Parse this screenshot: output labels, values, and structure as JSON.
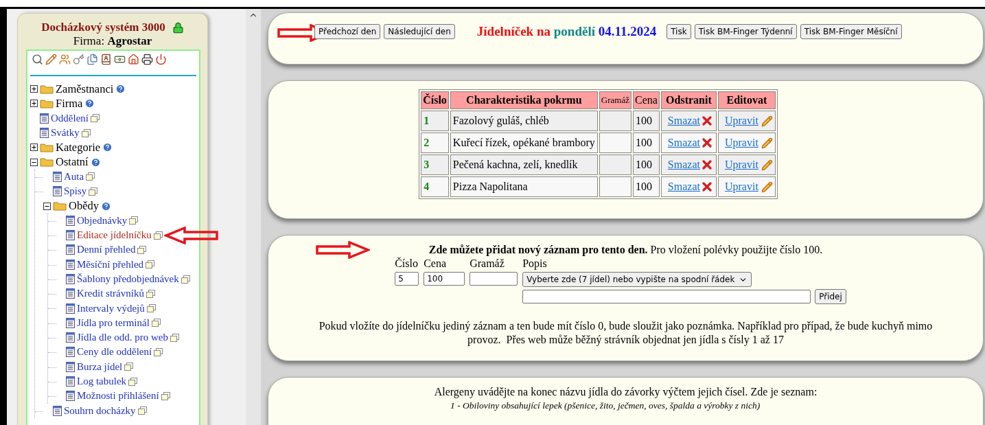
{
  "sidebar": {
    "title": "Docházkový systém 3000",
    "company_label": "Firma:",
    "company": "Agrostar",
    "tree": [
      {
        "label": "Zaměstnanci",
        "kind": "folder",
        "expanded": false,
        "selected": false
      },
      {
        "label": "Firma",
        "kind": "folder",
        "expanded": false,
        "selected": false
      },
      {
        "label": "Oddělení",
        "kind": "page",
        "selected": false
      },
      {
        "label": "Svátky",
        "kind": "page",
        "selected": false
      },
      {
        "label": "Kategorie",
        "kind": "folder",
        "expanded": false,
        "selected": false
      },
      {
        "label": "Ostatní",
        "kind": "folder",
        "expanded": true,
        "selected": false,
        "children": [
          {
            "label": "Auta",
            "kind": "page",
            "selected": false
          },
          {
            "label": "Spisy",
            "kind": "page",
            "selected": false
          },
          {
            "label": "Obědy",
            "kind": "folder",
            "expanded": true,
            "selected": false,
            "children": [
              {
                "label": "Objednávky",
                "kind": "page",
                "selected": false
              },
              {
                "label": "Editace jídelníčku",
                "kind": "page",
                "selected": true
              },
              {
                "label": "Denní přehled",
                "kind": "page",
                "selected": false
              },
              {
                "label": "Měsíční přehled",
                "kind": "page",
                "selected": false
              },
              {
                "label": "Šablony předobjednávek",
                "kind": "page",
                "selected": false
              },
              {
                "label": "Kredit strávníků",
                "kind": "page",
                "selected": false
              },
              {
                "label": "Intervaly výdejů",
                "kind": "page",
                "selected": false
              },
              {
                "label": "Jídla pro terminál",
                "kind": "page",
                "selected": false
              },
              {
                "label": "Jídla dle odd. pro web",
                "kind": "page",
                "selected": false
              },
              {
                "label": "Ceny dle oddělení",
                "kind": "page",
                "selected": false
              },
              {
                "label": "Burza jídel",
                "kind": "page",
                "selected": false
              },
              {
                "label": "Log tabulek",
                "kind": "page",
                "selected": false
              },
              {
                "label": "Možnosti přihlášení",
                "kind": "page",
                "selected": false
              }
            ]
          },
          {
            "label": "Souhrn docházky",
            "kind": "page",
            "selected": false
          }
        ]
      }
    ]
  },
  "header": {
    "nav_buttons": [
      "Předchozí den",
      "Následující den"
    ],
    "title": "Jídelníček na",
    "day": "pondělí",
    "date": "04.11.2024",
    "print_buttons": [
      "Tisk",
      "Tisk BM-Finger Týdenní",
      "Tisk BM-Finger Měsíční"
    ]
  },
  "menu_table": {
    "columns": [
      {
        "label": "Číslo",
        "bold": true
      },
      {
        "label": "Charakteristika pokrmu",
        "bold": true
      },
      {
        "label": "Gramáž",
        "bold": false
      },
      {
        "label": "Cena",
        "bold": false
      },
      {
        "label": "Odstranit",
        "bold": true
      },
      {
        "label": "Editovat",
        "bold": true
      }
    ],
    "rows": [
      {
        "number": "1",
        "name": "Fazolový guláš, chléb",
        "price": "100",
        "delete": "Smazat",
        "edit": "Upravit"
      },
      {
        "number": "2",
        "name": "Kuřecí řízek, opékané brambory",
        "price": "100",
        "delete": "Smazat",
        "edit": "Upravit"
      },
      {
        "number": "3",
        "name": "Pečená kachna, zelí, knedlík",
        "price": "100",
        "delete": "Smazat",
        "edit": "Upravit"
      },
      {
        "number": "4",
        "name": "Pizza Napolitana",
        "price": "100",
        "delete": "Smazat",
        "edit": "Upravit"
      }
    ]
  },
  "add_form": {
    "intro": "**Zde můžete přidat nový záznam pro tento den.** Pro vložení polévky použijte číslo 100.",
    "fields": [
      {
        "label": "Číslo",
        "value": "5"
      },
      {
        "label": "Cena",
        "value": "100"
      },
      {
        "label": "Gramáž"
      }
    ],
    "description_label": "Popis",
    "select_value": "Vyberte zde (7 jídel) nebo vypište na spodní řádek",
    "add_button": "Přidej",
    "note": "Pokud vložíte do jídelníčku jediný záznam a ten bude mít číslo 0, bude sloužit jako poznámka. Například pro případ, že bude kuchyň mimo provoz.  Přes web může běžný strávník objednat jen jídla s čísly 1 až 17"
  },
  "allergens": {
    "intro": "Alergeny uvádějte na konec názvu jídla do závorky výčtem jejich čísel. Zde je seznam:",
    "items": [
      "1 - Obiloviny obsahující lepek (pšenice, žito, ječmen, oves, špalda a výrobky z nich)"
    ]
  }
}
